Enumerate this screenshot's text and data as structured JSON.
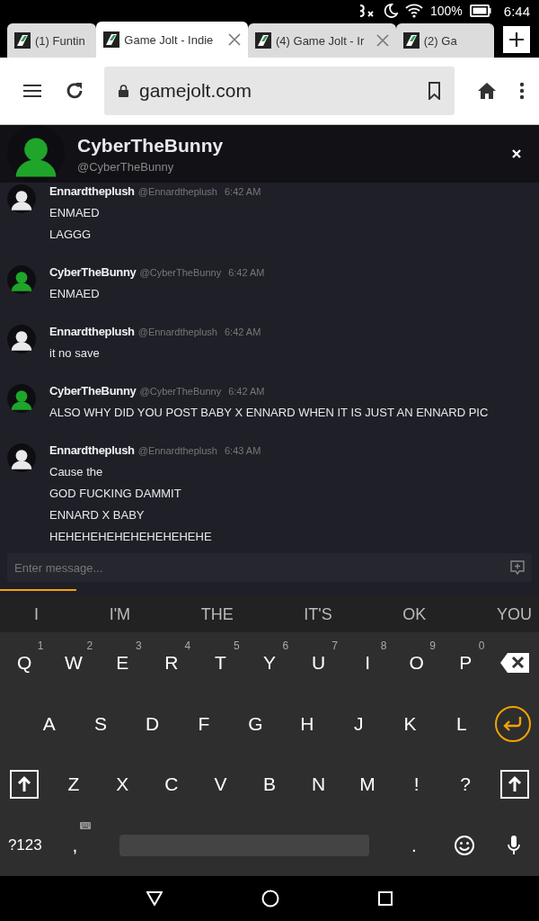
{
  "status_bar": {
    "battery": "100%",
    "time": "6:44"
  },
  "tabs": [
    {
      "title": "(1) Funtin",
      "selected": false,
      "closable": false
    },
    {
      "title": "Game Jolt - Indie",
      "selected": true,
      "closable": true
    },
    {
      "title": "(4) Game Jolt - Ir",
      "selected": false,
      "closable": true
    },
    {
      "title": "(2) Ga",
      "selected": false,
      "closable": false
    }
  ],
  "address_bar": {
    "url": "gamejolt.com"
  },
  "chat_header": {
    "name": "CyberTheBunny",
    "handle": "@CyberTheBunny",
    "color": "#1fa52a"
  },
  "messages": [
    {
      "author": "Ennardtheplush",
      "handle": "@Ennardtheplush",
      "time": "6:42 AM",
      "color": "#e8e8ea",
      "lines": [
        "ENMAED",
        "LAGGG"
      ]
    },
    {
      "author": "CyberTheBunny",
      "handle": "@CyberTheBunny",
      "time": "6:42 AM",
      "color": "#1fa52a",
      "lines": [
        "ENMAED"
      ]
    },
    {
      "author": "Ennardtheplush",
      "handle": "@Ennardtheplush",
      "time": "6:42 AM",
      "color": "#e8e8ea",
      "lines": [
        "it no save"
      ]
    },
    {
      "author": "CyberTheBunny",
      "handle": "@CyberTheBunny",
      "time": "6:42 AM",
      "color": "#1fa52a",
      "lines": [
        "ALSO WHY DID YOU POST BABY X ENNARD WHEN IT IS JUST AN ENNARD PIC"
      ]
    },
    {
      "author": "Ennardtheplush",
      "handle": "@Ennardtheplush",
      "time": "6:43 AM",
      "color": "#e8e8ea",
      "lines": [
        "Cause the",
        "GOD FUCKING DAMMIT",
        "ENNARD X BABY",
        "HEHEHEHEHEHEHEHEHEHE"
      ]
    }
  ],
  "message_input": {
    "placeholder": "Enter message..."
  },
  "suggestions": [
    "I",
    "I'M",
    "THE",
    "IT'S",
    "OK",
    "YOU"
  ],
  "keyboard": [
    [
      {
        "kind": "letter",
        "label": "Q",
        "hint": "1"
      },
      {
        "kind": "letter",
        "label": "W",
        "hint": "2"
      },
      {
        "kind": "letter",
        "label": "E",
        "hint": "3"
      },
      {
        "kind": "letter",
        "label": "R",
        "hint": "4"
      },
      {
        "kind": "letter",
        "label": "T",
        "hint": "5"
      },
      {
        "kind": "letter",
        "label": "Y",
        "hint": "6"
      },
      {
        "kind": "letter",
        "label": "U",
        "hint": "7"
      },
      {
        "kind": "letter",
        "label": "I",
        "hint": "8"
      },
      {
        "kind": "letter",
        "label": "O",
        "hint": "9"
      },
      {
        "kind": "letter",
        "label": "P",
        "hint": "0"
      },
      {
        "kind": "backspace"
      }
    ],
    [
      {
        "kind": "letter",
        "label": "A"
      },
      {
        "kind": "letter",
        "label": "S"
      },
      {
        "kind": "letter",
        "label": "D"
      },
      {
        "kind": "letter",
        "label": "F"
      },
      {
        "kind": "letter",
        "label": "G"
      },
      {
        "kind": "letter",
        "label": "H"
      },
      {
        "kind": "letter",
        "label": "J"
      },
      {
        "kind": "letter",
        "label": "K"
      },
      {
        "kind": "letter",
        "label": "L"
      },
      {
        "kind": "enter"
      }
    ],
    [
      {
        "kind": "shift"
      },
      {
        "kind": "letter",
        "label": "Z"
      },
      {
        "kind": "letter",
        "label": "X"
      },
      {
        "kind": "letter",
        "label": "C"
      },
      {
        "kind": "letter",
        "label": "V"
      },
      {
        "kind": "letter",
        "label": "B"
      },
      {
        "kind": "letter",
        "label": "N"
      },
      {
        "kind": "letter",
        "label": "M"
      },
      {
        "kind": "letter",
        "label": "!"
      },
      {
        "kind": "letter",
        "label": "?"
      },
      {
        "kind": "shift"
      }
    ],
    [
      {
        "kind": "symbols",
        "label": "?123"
      },
      {
        "kind": "comma",
        "label": ","
      },
      {
        "kind": "space"
      },
      {
        "kind": "letter",
        "label": "."
      },
      {
        "kind": "emoji"
      },
      {
        "kind": "mic"
      }
    ]
  ]
}
